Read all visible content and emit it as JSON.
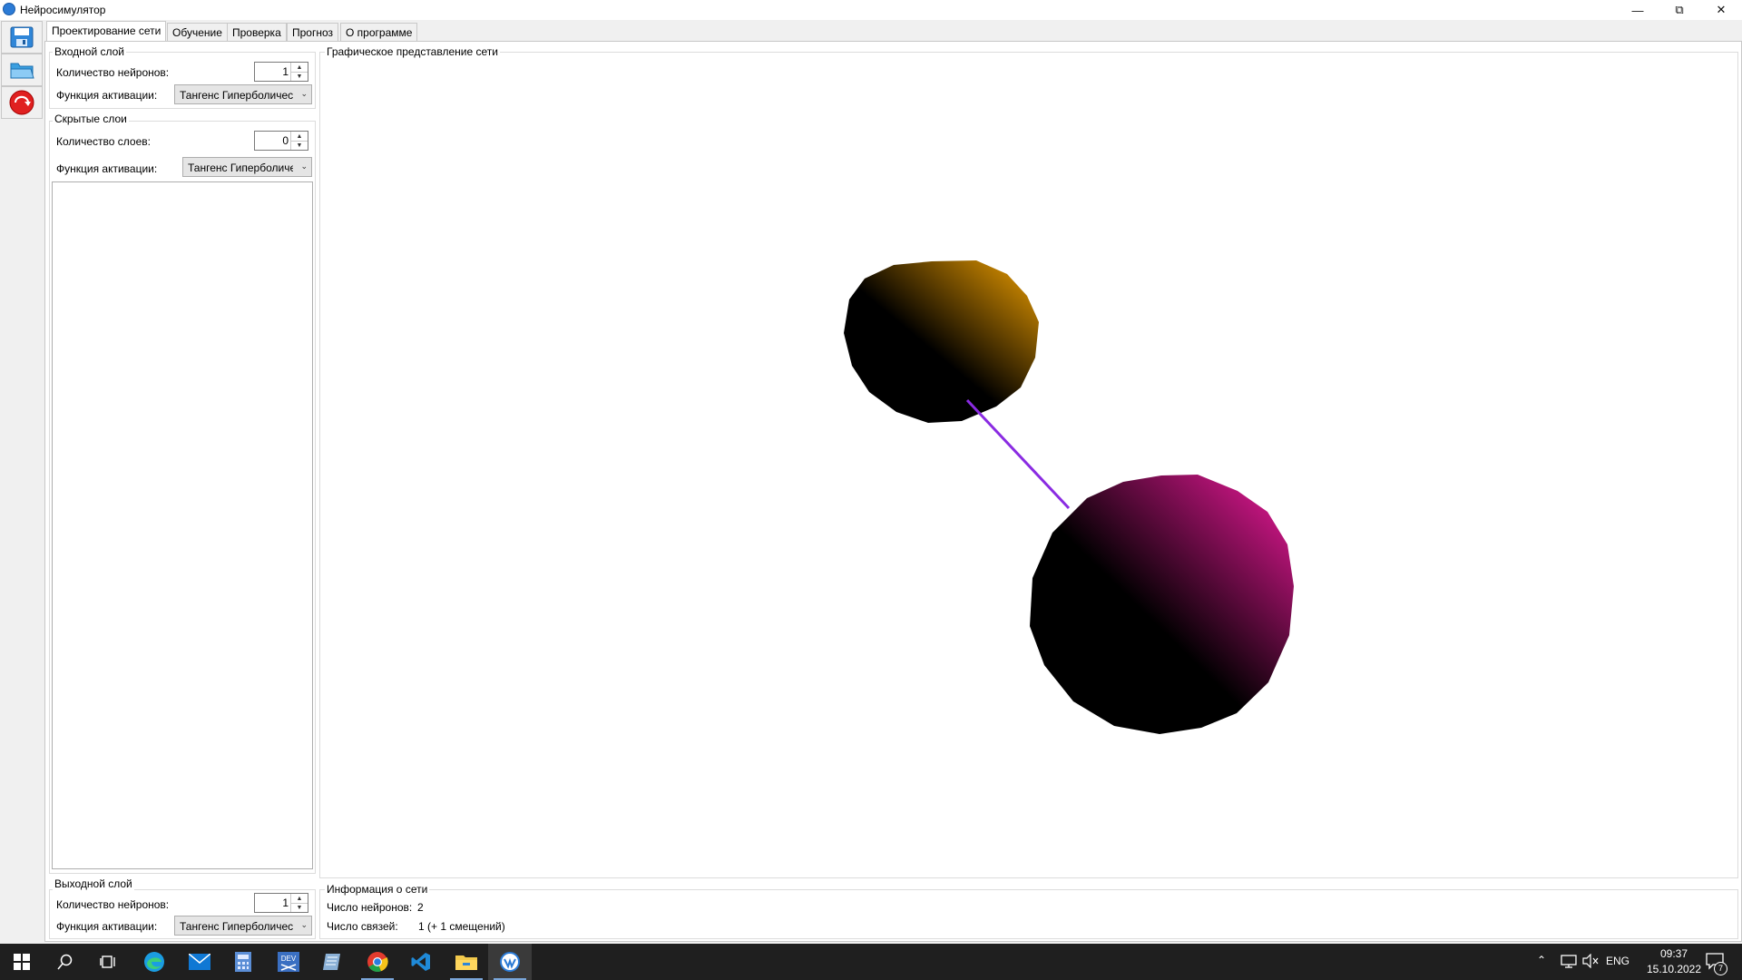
{
  "window": {
    "title": "Нейросимулятор",
    "icon": "app-icon"
  },
  "toolbar": {
    "save_icon": "floppy-disk-icon",
    "open_icon": "folder-icon",
    "exit_icon": "red-back-arrow-icon"
  },
  "tabs": [
    {
      "label": "Проектирование сети",
      "active": true
    },
    {
      "label": "Обучение"
    },
    {
      "label": "Проверка"
    },
    {
      "label": "Прогноз"
    },
    {
      "label": "О программе"
    }
  ],
  "input_layer": {
    "title": "Входной слой",
    "neurons_label": "Количество нейронов:",
    "neurons_value": "1",
    "activation_label": "Функция активации:",
    "activation_value": "Тангенс Гиперболичес"
  },
  "hidden_layers": {
    "title": "Скрытые слои",
    "layers_label": "Количество слоев:",
    "layers_value": "0",
    "activation_label": "Функция активации:",
    "activation_value": "Тангенс Гиперболиче"
  },
  "output_layer": {
    "title": "Выходной слой",
    "neurons_label": "Количество нейронов:",
    "neurons_value": "1",
    "activation_label": "Функция активации:",
    "activation_value": "Тангенс Гиперболичес"
  },
  "graph": {
    "title": "Графическое представление сети",
    "colors": {
      "input_neuron": "#f0a000",
      "output_neuron": "#f21a9e",
      "connection": "#8a2be2"
    }
  },
  "info": {
    "title": "Информация о сети",
    "neurons_label": "Число нейронов:",
    "neurons_value": "2",
    "links_label": "Число связей:",
    "links_value": "1 (+ 1 смещений)"
  },
  "taskbar": {
    "icons": [
      "windows-start-icon",
      "search-icon",
      "task-view-icon",
      "edge-browser-icon",
      "mail-icon",
      "calculator-icon",
      "devexpress-icon",
      "notepad-icon",
      "chrome-icon",
      "vscode-icon",
      "file-explorer-icon",
      "neurosimulator-icon"
    ],
    "language": "ENG",
    "time": "09:37",
    "date": "15.10.2022",
    "notifications": "7"
  }
}
